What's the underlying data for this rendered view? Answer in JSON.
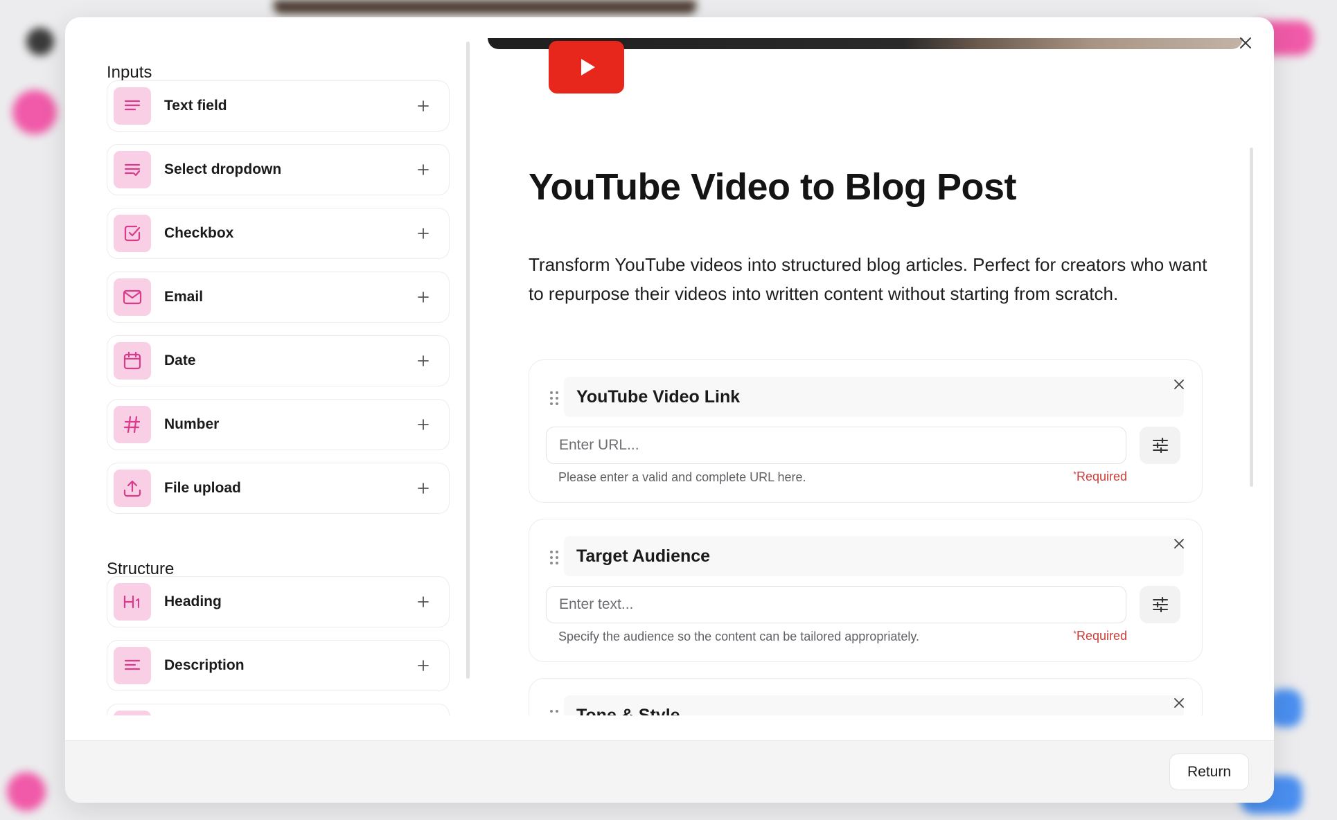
{
  "backdrop": {
    "accent_pink": "#f05aa8",
    "accent_blue": "#4a8ff0"
  },
  "left_panel": {
    "inputs_title": "Inputs",
    "inputs": [
      {
        "label": "Text field",
        "icon": "text-lines-icon"
      },
      {
        "label": "Select dropdown",
        "icon": "list-check-icon"
      },
      {
        "label": "Checkbox",
        "icon": "checkbox-icon"
      },
      {
        "label": "Email",
        "icon": "envelope-icon"
      },
      {
        "label": "Date",
        "icon": "calendar-icon"
      },
      {
        "label": "Number",
        "icon": "hash-icon"
      },
      {
        "label": "File upload",
        "icon": "upload-icon"
      }
    ],
    "structure_title": "Structure",
    "structure": [
      {
        "label": "Heading",
        "icon": "h1-icon"
      },
      {
        "label": "Description",
        "icon": "paragraph-icon"
      }
    ]
  },
  "form": {
    "title": "YouTube Video to Blog Post",
    "description": "Transform YouTube videos into structured blog articles. Perfect for creators who want to repurpose their videos into written content without starting from scratch.",
    "fields": [
      {
        "title": "YouTube Video Link",
        "placeholder": "Enter URL...",
        "help": "Please enter a valid and complete URL here.",
        "required_label": "Required"
      },
      {
        "title": "Target Audience",
        "placeholder": "Enter text...",
        "help": "Specify the audience so the content can be tailored appropriately.",
        "required_label": "Required"
      },
      {
        "title": "Tone & Style"
      }
    ]
  },
  "footer": {
    "return_label": "Return"
  },
  "colors": {
    "icon_tile_bg": "#f8cfe5",
    "icon_tile_fg": "#d93a8c",
    "youtube_red": "#e8271c",
    "required_red": "#c8403a"
  }
}
